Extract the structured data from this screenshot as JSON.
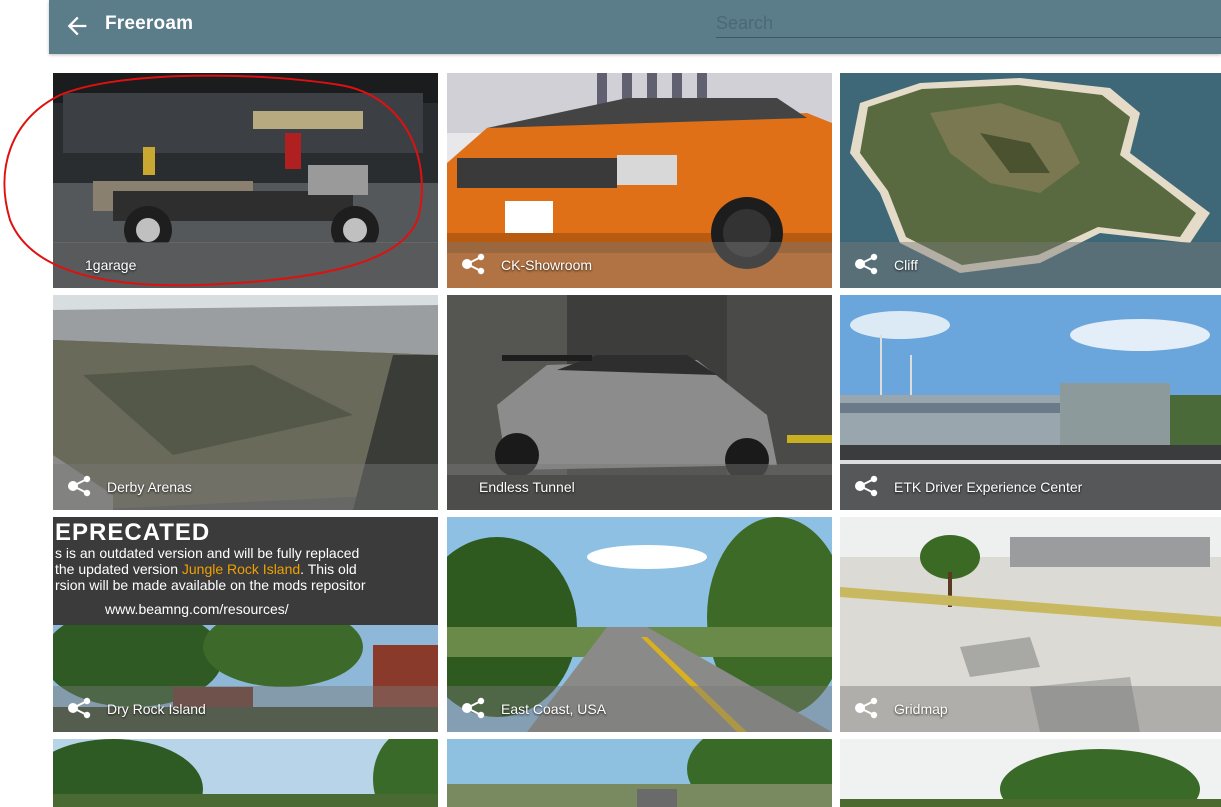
{
  "header": {
    "title": "Freeroam",
    "search_placeholder": "Search"
  },
  "tiles": [
    {
      "label": "1garage",
      "modded": false
    },
    {
      "label": "CK-Showroom",
      "modded": true
    },
    {
      "label": "Cliff",
      "modded": true
    },
    {
      "label": "Derby Arenas",
      "modded": true
    },
    {
      "label": "Endless Tunnel",
      "modded": false
    },
    {
      "label": "ETK Driver Experience Center",
      "modded": true
    },
    {
      "label": "Dry Rock Island",
      "modded": true
    },
    {
      "label": "East Coast, USA",
      "modded": true
    },
    {
      "label": "Gridmap",
      "modded": true
    }
  ],
  "deprecated_notice": {
    "heading": "EPRECATED",
    "line1": "s is an outdated version and will be fully replaced",
    "line2a": "the updated version ",
    "line2b": "Jungle Rock Island",
    "line2c": ". This old",
    "line3": "rsion will be made available on the mods repositor",
    "url": "www.beamng.com/resources/"
  },
  "colors": {
    "header_bg": "#5b7c89",
    "highlight_annotation": "#e01010",
    "deprecated_link": "#f0a000"
  },
  "icons": {
    "back": "arrow-left-icon",
    "mod": "mod-share-icon"
  }
}
